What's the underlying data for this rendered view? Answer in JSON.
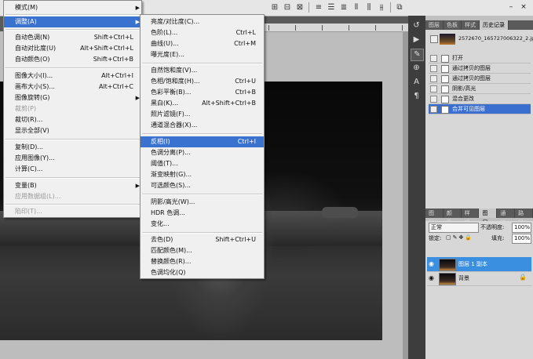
{
  "main_menu": {
    "items": [
      {
        "id": "mode",
        "label": "模式(M)",
        "shortcut": "",
        "arrow": true,
        "state": "normal"
      },
      {
        "id": "adjust",
        "label": "调整(A)",
        "shortcut": "",
        "arrow": true,
        "state": "selected"
      },
      {
        "id": "auto-tone",
        "label": "自动色调(N)",
        "shortcut": "Shift+Ctrl+L",
        "arrow": false,
        "state": "normal"
      },
      {
        "id": "auto-contrast",
        "label": "自动对比度(U)",
        "shortcut": "Alt+Shift+Ctrl+L",
        "arrow": false,
        "state": "normal"
      },
      {
        "id": "auto-color",
        "label": "自动颜色(O)",
        "shortcut": "Shift+Ctrl+B",
        "arrow": false,
        "state": "normal"
      },
      {
        "id": "image-size",
        "label": "图像大小(I)...",
        "shortcut": "Alt+Ctrl+I",
        "arrow": false,
        "state": "normal"
      },
      {
        "id": "canvas-size",
        "label": "画布大小(S)...",
        "shortcut": "Alt+Ctrl+C",
        "arrow": false,
        "state": "normal"
      },
      {
        "id": "image-rotation",
        "label": "图像旋转(G)",
        "shortcut": "",
        "arrow": true,
        "state": "normal"
      },
      {
        "id": "crop",
        "label": "裁剪(P)",
        "shortcut": "",
        "arrow": false,
        "state": "disabled"
      },
      {
        "id": "trim",
        "label": "裁切(R)...",
        "shortcut": "",
        "arrow": false,
        "state": "normal"
      },
      {
        "id": "reveal-all",
        "label": "显示全部(V)",
        "shortcut": "",
        "arrow": false,
        "state": "normal"
      },
      {
        "id": "duplicate",
        "label": "复制(D)...",
        "shortcut": "",
        "arrow": false,
        "state": "normal"
      },
      {
        "id": "apply-image",
        "label": "应用图像(Y)...",
        "shortcut": "",
        "arrow": false,
        "state": "normal"
      },
      {
        "id": "calculations",
        "label": "计算(C)...",
        "shortcut": "",
        "arrow": false,
        "state": "normal"
      },
      {
        "id": "variables",
        "label": "变量(B)",
        "shortcut": "",
        "arrow": true,
        "state": "normal"
      },
      {
        "id": "apply-data-set",
        "label": "应用数据组(L)...",
        "shortcut": "",
        "arrow": false,
        "state": "disabled"
      },
      {
        "id": "trap",
        "label": "陷印(T)...",
        "shortcut": "",
        "arrow": false,
        "state": "disabled"
      }
    ]
  },
  "adjust_menu": {
    "items": [
      {
        "id": "brightness-contrast",
        "label": "亮度/对比度(C)...",
        "shortcut": "",
        "state": "normal"
      },
      {
        "id": "levels",
        "label": "色阶(L)...",
        "shortcut": "Ctrl+L",
        "state": "normal"
      },
      {
        "id": "curves",
        "label": "曲线(U)...",
        "shortcut": "Ctrl+M",
        "state": "normal"
      },
      {
        "id": "exposure",
        "label": "曝光度(E)...",
        "shortcut": "",
        "state": "normal"
      },
      {
        "id": "vibrance",
        "label": "自然饱和度(V)...",
        "shortcut": "",
        "state": "normal"
      },
      {
        "id": "hue-saturation",
        "label": "色相/饱和度(H)...",
        "shortcut": "Ctrl+U",
        "state": "normal"
      },
      {
        "id": "color-balance",
        "label": "色彩平衡(B)...",
        "shortcut": "Ctrl+B",
        "state": "normal"
      },
      {
        "id": "black-white",
        "label": "黑白(K)...",
        "shortcut": "Alt+Shift+Ctrl+B",
        "state": "normal"
      },
      {
        "id": "photo-filter",
        "label": "照片滤镜(F)...",
        "shortcut": "",
        "state": "normal"
      },
      {
        "id": "channel-mixer",
        "label": "通道混合器(X)...",
        "shortcut": "",
        "state": "normal"
      },
      {
        "id": "invert",
        "label": "反相(I)",
        "shortcut": "Ctrl+I",
        "state": "selected"
      },
      {
        "id": "posterize",
        "label": "色调分离(P)...",
        "shortcut": "",
        "state": "normal"
      },
      {
        "id": "threshold",
        "label": "阈值(T)...",
        "shortcut": "",
        "state": "normal"
      },
      {
        "id": "gradient-map",
        "label": "渐变映射(G)...",
        "shortcut": "",
        "state": "normal"
      },
      {
        "id": "selective-color",
        "label": "可选颜色(S)...",
        "shortcut": "",
        "state": "normal"
      },
      {
        "id": "shadows-highlights",
        "label": "阴影/高光(W)...",
        "shortcut": "",
        "state": "normal"
      },
      {
        "id": "hdr-toning",
        "label": "HDR 色调...",
        "shortcut": "",
        "state": "normal"
      },
      {
        "id": "variations",
        "label": "变化...",
        "shortcut": "",
        "state": "normal"
      },
      {
        "id": "desaturate",
        "label": "去色(D)",
        "shortcut": "Shift+Ctrl+U",
        "state": "normal"
      },
      {
        "id": "match-color",
        "label": "匹配颜色(M)...",
        "shortcut": "",
        "state": "normal"
      },
      {
        "id": "replace-color",
        "label": "替换颜色(R)...",
        "shortcut": "",
        "state": "normal"
      },
      {
        "id": "equalize",
        "label": "色调均化(Q)",
        "shortcut": "",
        "state": "normal"
      }
    ]
  },
  "history_panel": {
    "tabs": [
      "图层",
      "色板",
      "样式",
      "历史记录"
    ],
    "active_tab": "历史记录",
    "snapshot_name": "2572670_165727006322_2.jpg",
    "steps": [
      "打开",
      "通过拷贝的图层",
      "通过拷贝的图层",
      "阴影/高光",
      "混合更改",
      "合并可见图层"
    ],
    "selected_step": "合并可见图层"
  },
  "layers_panel": {
    "tabs": [
      "图层",
      "颜色",
      "样式",
      "图层",
      "通道",
      "路径"
    ],
    "active_tab": "图层",
    "blend_mode": "正常",
    "opacity_label": "不透明度:",
    "opacity_value": "100%",
    "lock_label": "锁定:",
    "fill_label": "填充:",
    "fill_value": "100%",
    "layers": [
      {
        "name": "图层 1 副本",
        "selected": true,
        "locked": false
      },
      {
        "name": "背景",
        "selected": false,
        "locked": true
      }
    ]
  },
  "icons": {
    "eye": "eye-icon",
    "lock": "lock-icon",
    "submenu_arrow": "chevron-right-icon"
  },
  "colors": {
    "menu_highlight": "#3a72d0",
    "layer_highlight": "#3a8fe0"
  }
}
